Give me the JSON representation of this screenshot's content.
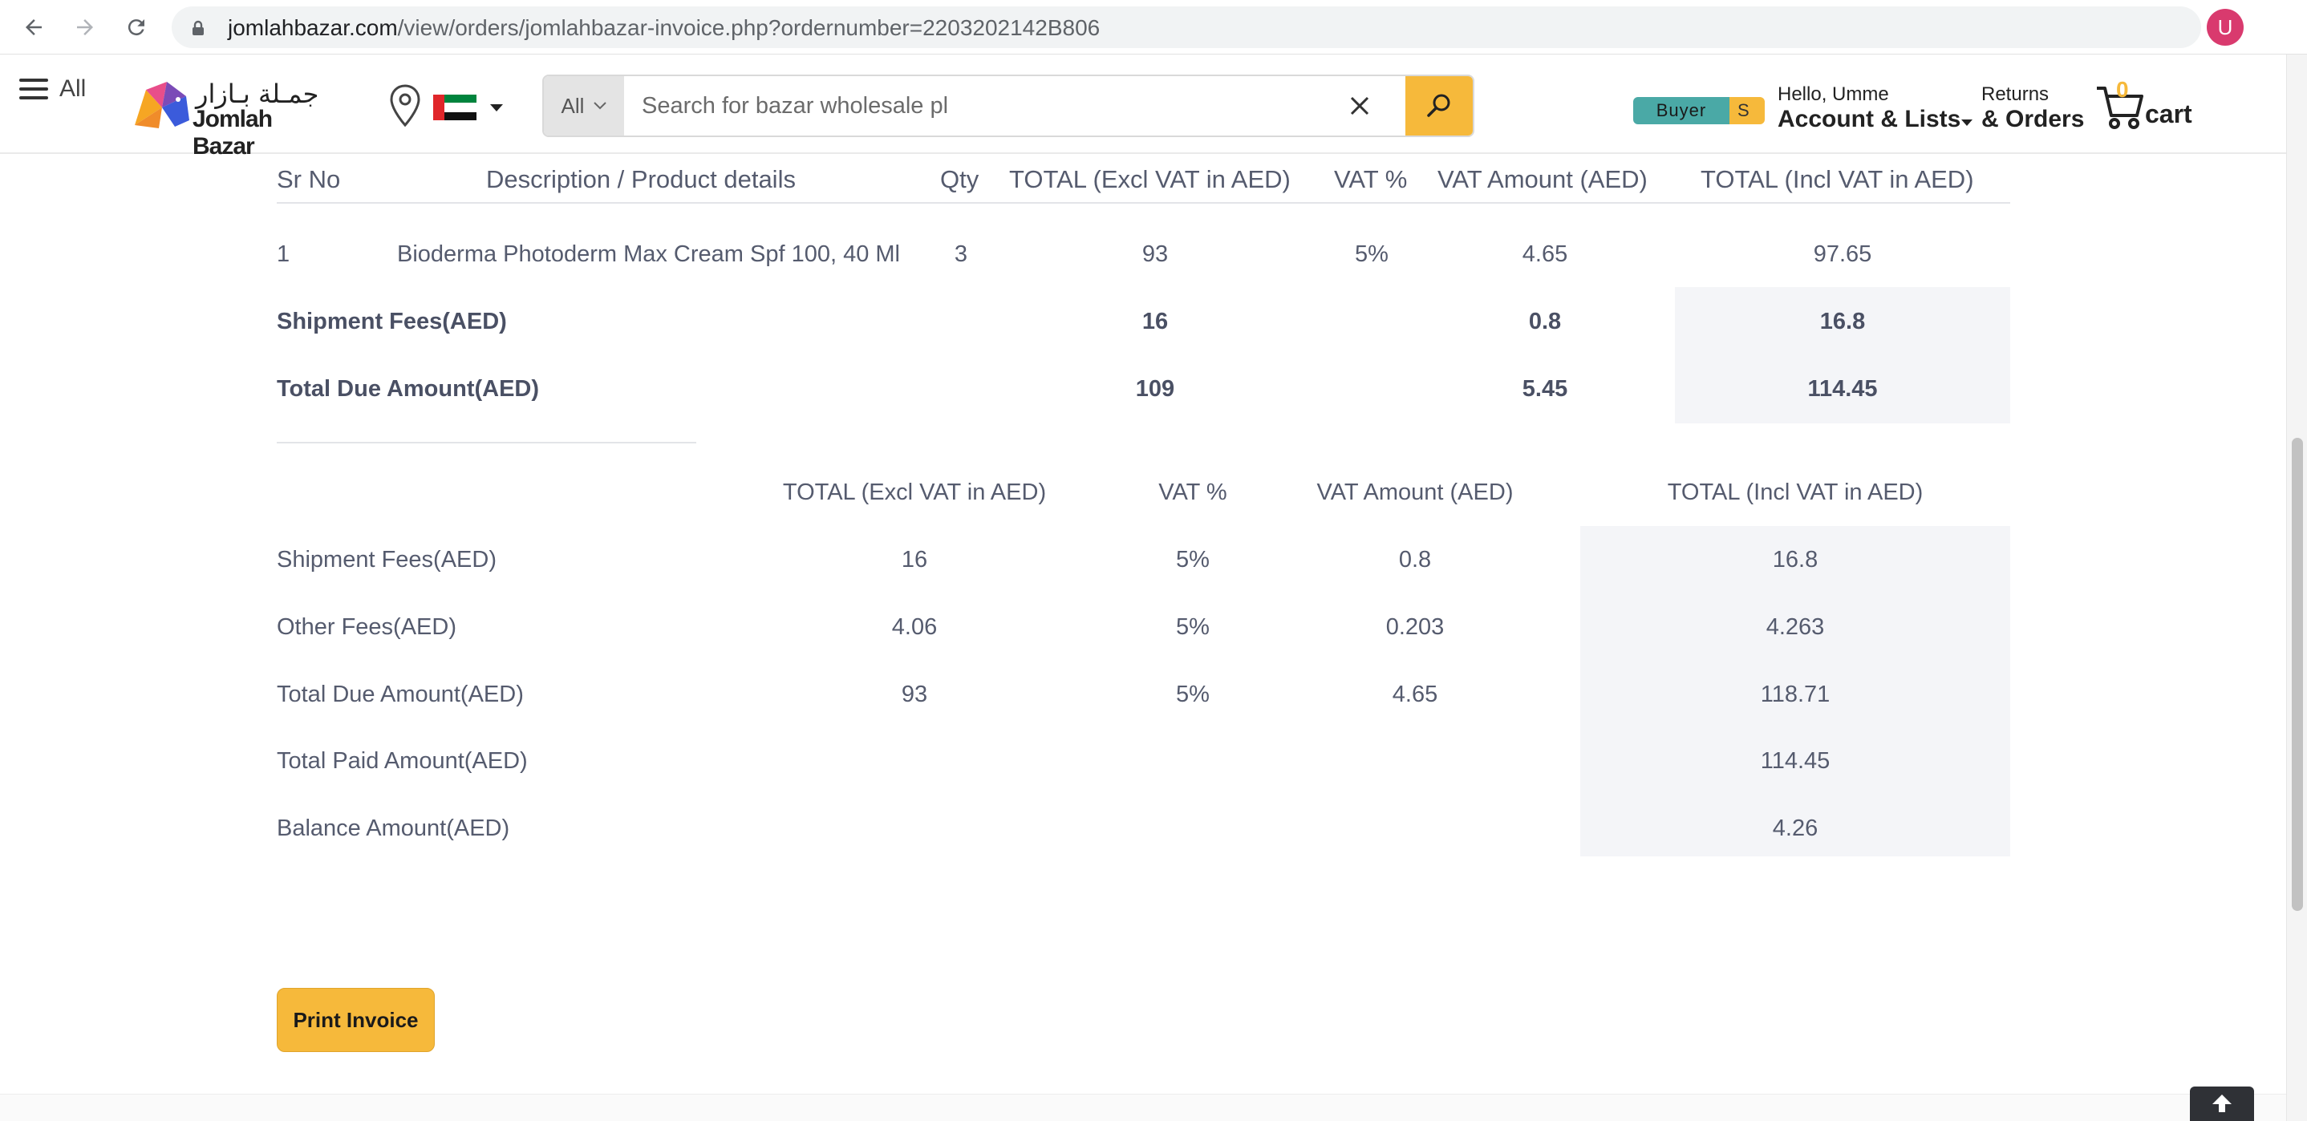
{
  "browser": {
    "url_host": "jomlahbazar.com",
    "url_path": "/view/orders/jomlahbazar-invoice.php?ordernumber=2203202142B806",
    "profile_initial": "U"
  },
  "header": {
    "menu_label": "All",
    "logo_ar": "جمـلة بـازار",
    "logo_en": "Jomlah Bazar",
    "search_category": "All",
    "search_placeholder": "Search for bazar wholesale pl",
    "buyer_label": "Buyer",
    "seller_label": "S",
    "greeting": "Hello, Umme",
    "account_label": "Account & Lists",
    "returns_label": "Returns",
    "orders_label": "& Orders",
    "cart_count": "0",
    "cart_label": "cart",
    "colors": {
      "accent": "#f6b93b",
      "teal": "#4aa9a6"
    }
  },
  "items_table": {
    "headers": [
      "Sr No",
      "Description / Product details",
      "Qty",
      "TOTAL (Excl VAT in AED)",
      "VAT %",
      "VAT Amount (AED)",
      "TOTAL (Incl VAT in AED)"
    ],
    "rows": [
      {
        "sr": "1",
        "desc": "Bioderma Photoderm Max Cream Spf 100, 40 Ml",
        "qty": "3",
        "excl": "93",
        "vat_pct": "5%",
        "vat_amt": "4.65",
        "incl": "97.65"
      }
    ],
    "shipment": {
      "label": "Shipment Fees(AED)",
      "excl": "16",
      "vat_amt": "0.8",
      "incl": "16.8"
    },
    "total_due": {
      "label": "Total Due Amount(AED)",
      "excl": "109",
      "vat_amt": "5.45",
      "incl": "114.45"
    }
  },
  "summary_table": {
    "headers": [
      "TOTAL (Excl VAT in AED)",
      "VAT %",
      "VAT Amount (AED)",
      "TOTAL (Incl VAT in AED)"
    ],
    "rows": [
      {
        "label": "Shipment Fees(AED)",
        "excl": "16",
        "vat_pct": "5%",
        "vat_amt": "0.8",
        "incl": "16.8"
      },
      {
        "label": "Other Fees(AED)",
        "excl": "4.06",
        "vat_pct": "5%",
        "vat_amt": "0.203",
        "incl": "4.263"
      },
      {
        "label": "Total Due Amount(AED)",
        "excl": "93",
        "vat_pct": "5%",
        "vat_amt": "4.65",
        "incl": "118.71"
      },
      {
        "label": "Total Paid Amount(AED)",
        "excl": "",
        "vat_pct": "",
        "vat_amt": "",
        "incl": "114.45"
      },
      {
        "label": "Balance Amount(AED)",
        "excl": "",
        "vat_pct": "",
        "vat_amt": "",
        "incl": "4.26"
      }
    ]
  },
  "actions": {
    "print_label": "Print Invoice"
  }
}
